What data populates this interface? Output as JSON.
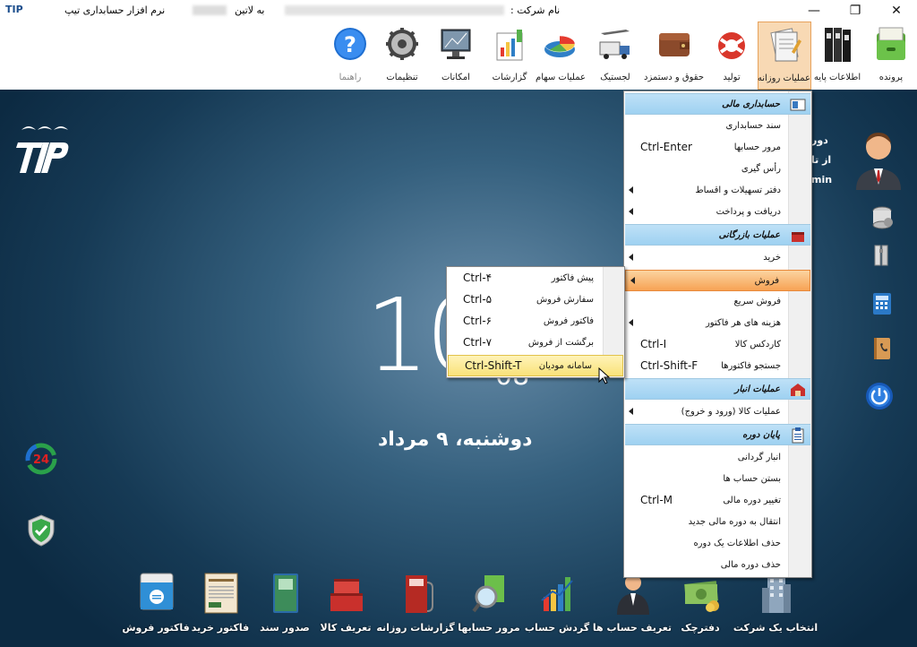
{
  "titlebar": {
    "app_logo": "TIP",
    "app_name": "نرم افزار حسابداری تیپ",
    "latin_label": "به لاتین",
    "company_label": "نام شرکت :",
    "minimize": "—",
    "restore": "❐",
    "close": "✕"
  },
  "ribbon": [
    {
      "label": "پرونده",
      "icon": "folder-icon"
    },
    {
      "label": "اطلاعات پایه",
      "icon": "binders-icon"
    },
    {
      "label": "عملیات روزانه",
      "icon": "documents-icon",
      "active": true
    },
    {
      "label": "تولید",
      "icon": "lifebuoy-icon"
    },
    {
      "label": "حقوق و دستمزد",
      "icon": "wallet-icon"
    },
    {
      "label": "لجستیک",
      "icon": "truck-icon"
    },
    {
      "label": "عملیات سهام",
      "icon": "pie-chart-icon"
    },
    {
      "label": "گزارشات",
      "icon": "report-icon"
    },
    {
      "label": "امکانات",
      "icon": "monitor-icon"
    },
    {
      "label": "تنظیمات",
      "icon": "gear-icon"
    },
    {
      "label": "راهنما",
      "icon": "help-icon"
    }
  ],
  "clock": {
    "big": "10",
    "small": "08"
  },
  "date": "دوشنبه، ۹ مرداد",
  "user_panel": {
    "line1": "دور",
    "line2": "از تا",
    "line3": "min"
  },
  "menu": {
    "hdr_fin": "حسابداری مالی",
    "doc": "سند حسابداری",
    "review": "مرور حسابها",
    "review_sc": "Ctrl-Enter",
    "ras": "رأس گیری",
    "loans": "دفتر تسهیلات و اقساط",
    "recv_pay": "دریافت و پرداخت",
    "hdr_trade": "عملیات بازرگانی",
    "purchase": "خرید",
    "sales": "فروش",
    "quick_sale": "فروش سریع",
    "invoice_costs": "هزینه های هر فاکتور",
    "cardex": "کاردکس کالا",
    "cardex_sc": "Ctrl-I",
    "search_inv": "جستجو فاکتورها",
    "search_inv_sc": "Ctrl-Shift-F",
    "hdr_store": "عملیات انبار",
    "goods_ops": "عملیات کالا (ورود و خروج)",
    "hdr_end": "پایان دوره",
    "inventory": "انبار گردانی",
    "close_acc": "بستن حساب ها",
    "change_year": "تغییر دوره مالی",
    "change_year_sc": "Ctrl-M",
    "transfer": "انتقال به دوره مالی جدید",
    "delete_info": "حذف اطلاعات یک دوره",
    "delete_year": "حذف دوره مالی"
  },
  "submenu": {
    "pre_invoice": "پیش فاکتور",
    "pre_invoice_sc": "Ctrl-۴",
    "order": "سفارش فروش",
    "order_sc": "Ctrl-۵",
    "invoice": "فاکتور فروش",
    "invoice_sc": "Ctrl-۶",
    "return": "برگشت از فروش",
    "return_sc": "Ctrl-۷",
    "debtors": "سامانه مودیان",
    "debtors_sc": "Ctrl-Shift-T"
  },
  "bottom": [
    {
      "label": "فاکتور فروش",
      "icon": "sales-invoice-icon"
    },
    {
      "label": "فاکتور خرید",
      "icon": "purchase-invoice-icon"
    },
    {
      "label": "صدور سند",
      "icon": "issue-document-icon"
    },
    {
      "label": "تعریف کالا",
      "icon": "define-goods-icon"
    },
    {
      "label": "گزارشات روزانه",
      "icon": "daily-reports-icon"
    },
    {
      "label": "مرور حسابها",
      "icon": "review-accounts-icon"
    },
    {
      "label": "گردش حساب",
      "icon": "account-turnover-icon"
    },
    {
      "label": "تعریف حساب ها",
      "icon": "define-accounts-icon"
    },
    {
      "label": "دفترچک",
      "icon": "checkbook-icon"
    },
    {
      "label": "انتخاب یک شرکت",
      "icon": "select-company-icon"
    }
  ]
}
